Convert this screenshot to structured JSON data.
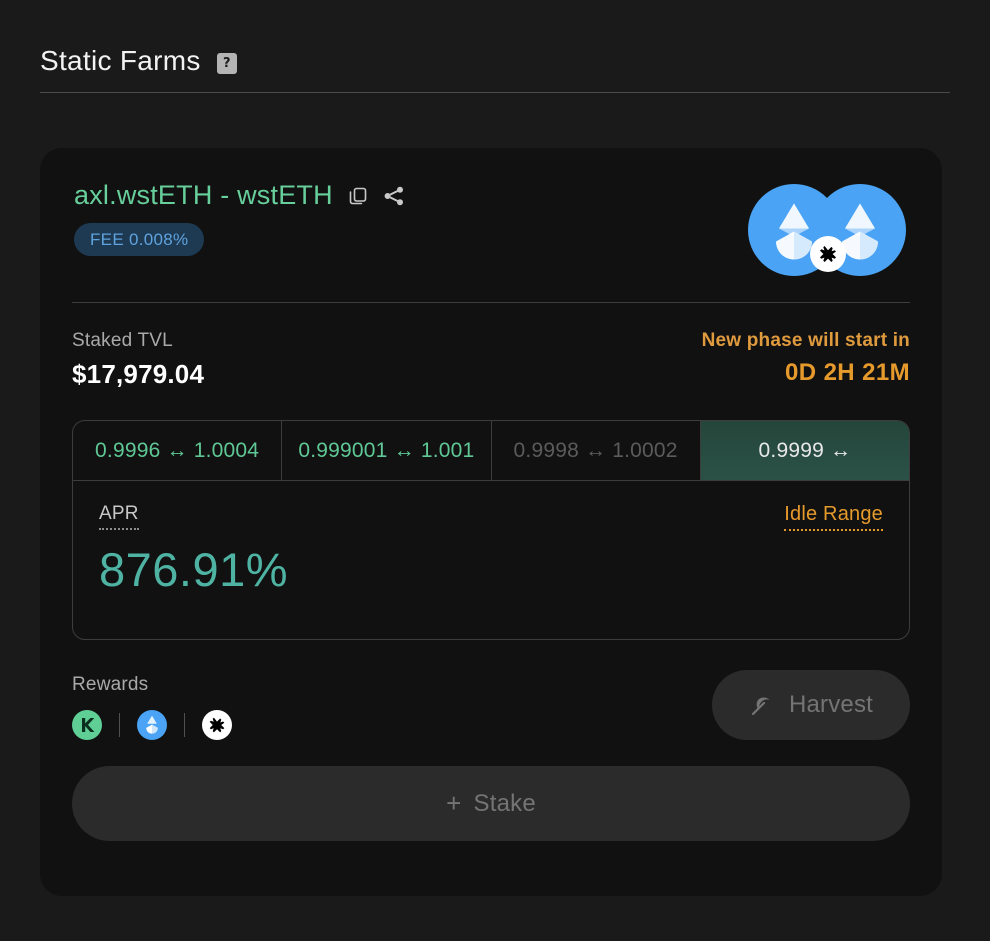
{
  "page": {
    "title": "Static Farms",
    "help_badge": "?"
  },
  "card": {
    "pair_name": "axl.wstETH - wstETH",
    "copy_icon": "copy-icon",
    "share_icon": "share-icon",
    "fee_badge": "FEE 0.008%",
    "token_logos": [
      "wsteth-logo",
      "wsteth-logo",
      "axelar-badge-icon"
    ],
    "staked_tvl": {
      "label": "Staked TVL",
      "value": "$17,979.04"
    },
    "phase": {
      "label": "New phase will start in",
      "timer": "0D 2H 21M"
    },
    "range_tabs": [
      {
        "label": "0.9996 ↔ 1.0004",
        "state": "normal"
      },
      {
        "label": "0.999001 ↔ 1.001",
        "state": "normal"
      },
      {
        "label": "0.9998 ↔ 1.0002",
        "state": "dim"
      },
      {
        "label": "0.9999 ↔",
        "state": "active"
      }
    ],
    "apr": {
      "label": "APR",
      "value": "876.91%",
      "idle_range": "Idle Range"
    },
    "rewards": {
      "label": "Rewards",
      "tokens": [
        "kava-token-icon",
        "lido-token-icon",
        "axelar-token-icon"
      ]
    },
    "harvest_button": {
      "label": "Harvest",
      "icon": "pickaxe-icon"
    },
    "stake_button": {
      "label": "Stake",
      "icon": "plus-icon"
    }
  },
  "colors": {
    "page_bg": "#1a1a1a",
    "card_bg": "#111111",
    "accent_green": "#67cf9b",
    "accent_teal": "#4fb3a3",
    "accent_orange": "#e79a2c",
    "accent_blue": "#5fa2dd",
    "token_blue": "#4aa3f5",
    "kava_green": "#5fcf96"
  }
}
